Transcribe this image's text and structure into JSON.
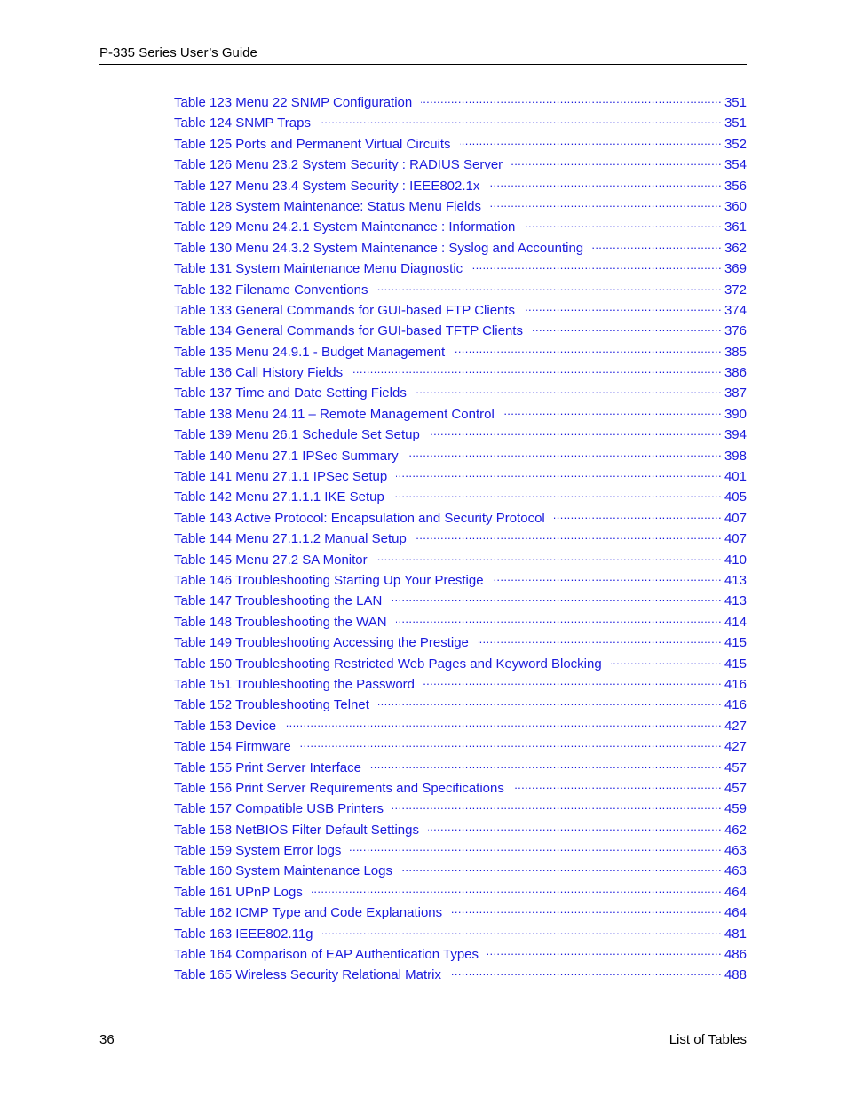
{
  "header": {
    "title": "P-335 Series User’s Guide"
  },
  "toc": {
    "entries": [
      {
        "title": "Table 123 Menu 22 SNMP Configuration",
        "page": "351"
      },
      {
        "title": "Table 124 SNMP Traps",
        "page": "351"
      },
      {
        "title": "Table 125 Ports and Permanent Virtual Circuits",
        "page": "352"
      },
      {
        "title": "Table 126 Menu 23.2 System Security : RADIUS Server",
        "page": "354"
      },
      {
        "title": "Table 127 Menu 23.4 System Security : IEEE802.1x",
        "page": "356"
      },
      {
        "title": "Table 128 System Maintenance: Status Menu Fields",
        "page": "360"
      },
      {
        "title": "Table 129 Menu 24.2.1 System Maintenance : Information",
        "page": "361"
      },
      {
        "title": "Table 130 Menu 24.3.2 System Maintenance : Syslog and Accounting",
        "page": "362"
      },
      {
        "title": "Table 131 System Maintenance Menu Diagnostic",
        "page": "369"
      },
      {
        "title": "Table 132 Filename Conventions",
        "page": "372"
      },
      {
        "title": "Table 133 General Commands for GUI-based FTP Clients",
        "page": "374"
      },
      {
        "title": "Table 134 General Commands for GUI-based TFTP Clients",
        "page": "376"
      },
      {
        "title": "Table 135 Menu 24.9.1 - Budget Management",
        "page": "385"
      },
      {
        "title": "Table 136 Call History Fields",
        "page": "386"
      },
      {
        "title": "Table 137 Time and Date Setting Fields",
        "page": "387"
      },
      {
        "title": "Table 138 Menu 24.11 – Remote Management Control",
        "page": "390"
      },
      {
        "title": "Table 139 Menu 26.1 Schedule Set Setup",
        "page": "394"
      },
      {
        "title": "Table 140 Menu 27.1 IPSec Summary",
        "page": "398"
      },
      {
        "title": "Table 141 Menu 27.1.1 IPSec Setup",
        "page": "401"
      },
      {
        "title": "Table 142 Menu 27.1.1.1 IKE Setup",
        "page": "405"
      },
      {
        "title": "Table 143 Active Protocol: Encapsulation and Security Protocol",
        "page": "407"
      },
      {
        "title": "Table 144 Menu 27.1.1.2 Manual Setup",
        "page": "407"
      },
      {
        "title": "Table 145 Menu 27.2 SA Monitor",
        "page": "410"
      },
      {
        "title": "Table 146 Troubleshooting Starting Up Your Prestige",
        "page": "413"
      },
      {
        "title": "Table 147 Troubleshooting the LAN",
        "page": "413"
      },
      {
        "title": "Table 148 Troubleshooting the WAN",
        "page": "414"
      },
      {
        "title": "Table 149 Troubleshooting Accessing the Prestige",
        "page": "415"
      },
      {
        "title": "Table 150 Troubleshooting Restricted Web Pages and Keyword Blocking",
        "page": "415"
      },
      {
        "title": "Table 151 Troubleshooting the Password",
        "page": "416"
      },
      {
        "title": "Table 152 Troubleshooting Telnet",
        "page": "416"
      },
      {
        "title": "Table 153 Device",
        "page": "427"
      },
      {
        "title": "Table 154 Firmware",
        "page": "427"
      },
      {
        "title": "Table 155 Print Server Interface",
        "page": "457"
      },
      {
        "title": "Table 156 Print Server Requirements and Specifications",
        "page": "457"
      },
      {
        "title": "Table 157 Compatible USB Printers",
        "page": "459"
      },
      {
        "title": "Table 158 NetBIOS Filter Default Settings",
        "page": "462"
      },
      {
        "title": "Table 159 System Error logs",
        "page": "463"
      },
      {
        "title": "Table 160 System Maintenance Logs",
        "page": "463"
      },
      {
        "title": "Table 161 UPnP Logs",
        "page": "464"
      },
      {
        "title": "Table 162 ICMP Type and Code Explanations",
        "page": "464"
      },
      {
        "title": "Table 163 IEEE802.11g",
        "page": "481"
      },
      {
        "title": "Table 164 Comparison of EAP Authentication Types",
        "page": "486"
      },
      {
        "title": "Table 165 Wireless Security Relational Matrix",
        "page": "488"
      }
    ]
  },
  "footer": {
    "page_number": "36",
    "section": "List of Tables"
  },
  "colors": {
    "link": "#1a1adc",
    "text": "#000000"
  }
}
